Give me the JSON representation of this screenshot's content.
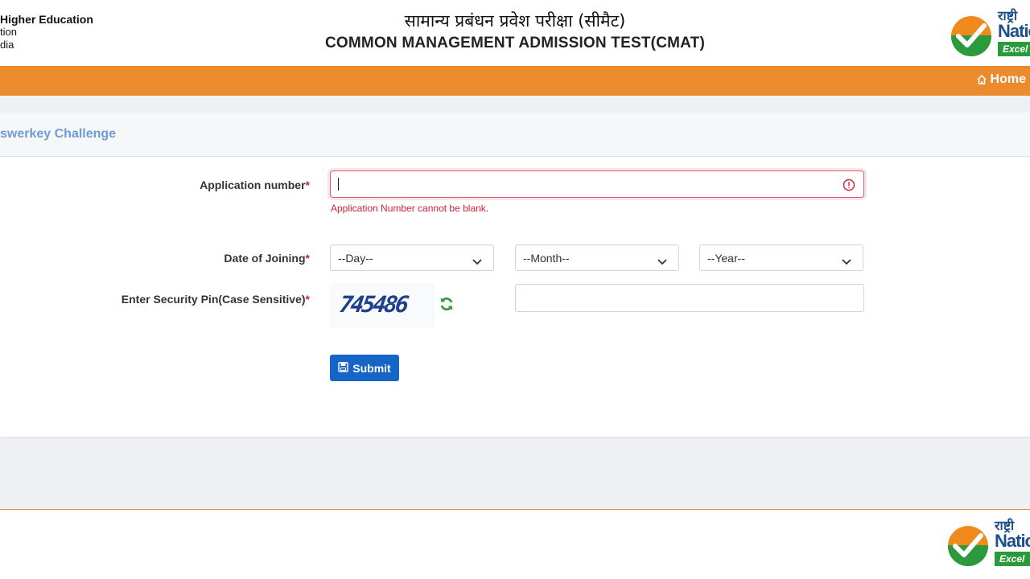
{
  "header": {
    "ministry_line1": "Higher Education",
    "ministry_line2": "tion",
    "ministry_line3": "dia",
    "title_hindi": "सामान्य प्रबंधन प्रवेश परीक्षा (सीमैट)",
    "title_english": "COMMON MANAGEMENT ADMISSION TEST(CMAT)",
    "logo_hindi": "राष्ट्री",
    "logo_english": "Natio",
    "logo_tagline": "Excel"
  },
  "nav": {
    "home_label": "Home",
    "home_icon": "home-icon"
  },
  "form": {
    "title": "swerkey Challenge",
    "application_label": "Application number",
    "application_value": "",
    "application_error": "Application Number cannot be blank.",
    "required_mark": "*",
    "doj_label": "Date of Joining",
    "day_selected": "--Day--",
    "month_selected": "--Month--",
    "year_selected": "--Year--",
    "pin_label": "Enter Security Pin(Case Sensitive)",
    "captcha_text": "745486",
    "pin_value": "",
    "submit_label": "Submit"
  },
  "footer": {
    "logo_hindi": "राष्ट्री",
    "logo_english": "Natio",
    "logo_tagline": "Excel"
  },
  "colors": {
    "accent_orange": "#ec8b2e",
    "link_blue": "#6f9bd8",
    "error_red": "#d0233a",
    "button_blue": "#1565c8"
  }
}
